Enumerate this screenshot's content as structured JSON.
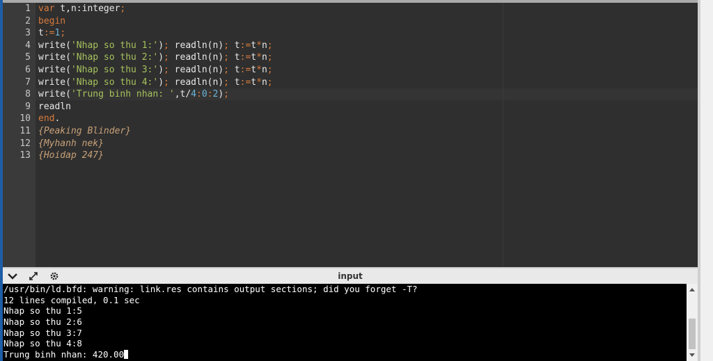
{
  "editor": {
    "lines": [
      {
        "num": "1",
        "segs": [
          {
            "t": "var",
            "c": "kw"
          },
          {
            "t": " t,n:integer",
            "c": ""
          },
          {
            "t": ";",
            "c": "op"
          }
        ]
      },
      {
        "num": "2",
        "segs": [
          {
            "t": "begin",
            "c": "kw"
          }
        ]
      },
      {
        "num": "3",
        "segs": [
          {
            "t": "t",
            "c": ""
          },
          {
            "t": ":=",
            "c": "op"
          },
          {
            "t": "1",
            "c": "num"
          },
          {
            "t": ";",
            "c": "op"
          }
        ]
      },
      {
        "num": "4",
        "segs": [
          {
            "t": "write(",
            "c": ""
          },
          {
            "t": "'Nhap so thu 1:'",
            "c": "str"
          },
          {
            "t": ")",
            "c": ""
          },
          {
            "t": ";",
            "c": "op"
          },
          {
            "t": " readln(n)",
            "c": ""
          },
          {
            "t": ";",
            "c": "op"
          },
          {
            "t": " t",
            "c": ""
          },
          {
            "t": ":=",
            "c": "op"
          },
          {
            "t": "t",
            "c": ""
          },
          {
            "t": "*",
            "c": "op"
          },
          {
            "t": "n",
            "c": ""
          },
          {
            "t": ";",
            "c": "op"
          }
        ]
      },
      {
        "num": "5",
        "segs": [
          {
            "t": "write(",
            "c": ""
          },
          {
            "t": "'Nhap so thu 2:'",
            "c": "str"
          },
          {
            "t": ")",
            "c": ""
          },
          {
            "t": ";",
            "c": "op"
          },
          {
            "t": " readln(n)",
            "c": ""
          },
          {
            "t": ";",
            "c": "op"
          },
          {
            "t": " t",
            "c": ""
          },
          {
            "t": ":=",
            "c": "op"
          },
          {
            "t": "t",
            "c": ""
          },
          {
            "t": "*",
            "c": "op"
          },
          {
            "t": "n",
            "c": ""
          },
          {
            "t": ";",
            "c": "op"
          }
        ]
      },
      {
        "num": "6",
        "segs": [
          {
            "t": "write(",
            "c": ""
          },
          {
            "t": "'Nhap so thu 3:'",
            "c": "str"
          },
          {
            "t": ")",
            "c": ""
          },
          {
            "t": ";",
            "c": "op"
          },
          {
            "t": " readln(n)",
            "c": ""
          },
          {
            "t": ";",
            "c": "op"
          },
          {
            "t": " t",
            "c": ""
          },
          {
            "t": ":=",
            "c": "op"
          },
          {
            "t": "t",
            "c": ""
          },
          {
            "t": "*",
            "c": "op"
          },
          {
            "t": "n",
            "c": ""
          },
          {
            "t": ";",
            "c": "op"
          }
        ]
      },
      {
        "num": "7",
        "segs": [
          {
            "t": "write(",
            "c": ""
          },
          {
            "t": "'Nhap so thu 4:'",
            "c": "str"
          },
          {
            "t": ")",
            "c": ""
          },
          {
            "t": ";",
            "c": "op"
          },
          {
            "t": " readln(n)",
            "c": ""
          },
          {
            "t": ";",
            "c": "op"
          },
          {
            "t": " t",
            "c": ""
          },
          {
            "t": ":=",
            "c": "op"
          },
          {
            "t": "t",
            "c": ""
          },
          {
            "t": "*",
            "c": "op"
          },
          {
            "t": "n",
            "c": ""
          },
          {
            "t": ";",
            "c": "op"
          }
        ]
      },
      {
        "num": "8",
        "segs": [
          {
            "t": "write(",
            "c": ""
          },
          {
            "t": "'Trung binh nhan: '",
            "c": "str"
          },
          {
            "t": ",t/",
            "c": ""
          },
          {
            "t": "4",
            "c": "num"
          },
          {
            "t": ":",
            "c": "op"
          },
          {
            "t": "0",
            "c": "num"
          },
          {
            "t": ":",
            "c": "op"
          },
          {
            "t": "2",
            "c": "num"
          },
          {
            "t": ")",
            "c": ""
          },
          {
            "t": ";",
            "c": "op"
          }
        ]
      },
      {
        "num": "9",
        "segs": [
          {
            "t": "readln",
            "c": ""
          }
        ]
      },
      {
        "num": "10",
        "segs": [
          {
            "t": "end",
            "c": "kw"
          },
          {
            "t": ".",
            "c": ""
          }
        ]
      },
      {
        "num": "11",
        "segs": [
          {
            "t": "{Peaking Blinder}",
            "c": "cmt"
          }
        ]
      },
      {
        "num": "12",
        "segs": [
          {
            "t": "{Myhanh nek}",
            "c": "cmt"
          }
        ]
      },
      {
        "num": "13",
        "segs": [
          {
            "t": "{Hoidap 247}",
            "c": "cmt"
          }
        ]
      }
    ]
  },
  "panel": {
    "title": "input",
    "icons": [
      "chevron-down-icon",
      "expand-icon",
      "gear-icon"
    ]
  },
  "console": {
    "lines": [
      "/usr/bin/ld.bfd: warning: link.res contains output sections; did you forget -T?",
      "12 lines compiled, 0.1 sec",
      "Nhap so thu 1:5",
      "Nhap so thu 2:6",
      "Nhap so thu 3:7",
      "Nhap so thu 4:8",
      "Trung binh nhan: 420.00"
    ]
  },
  "colors": {
    "editor_bg": "#2f2f2f",
    "keyword": "#d87b3c",
    "string": "#a5c25c",
    "number": "#6cb4d8",
    "comment": "#c8a178"
  }
}
